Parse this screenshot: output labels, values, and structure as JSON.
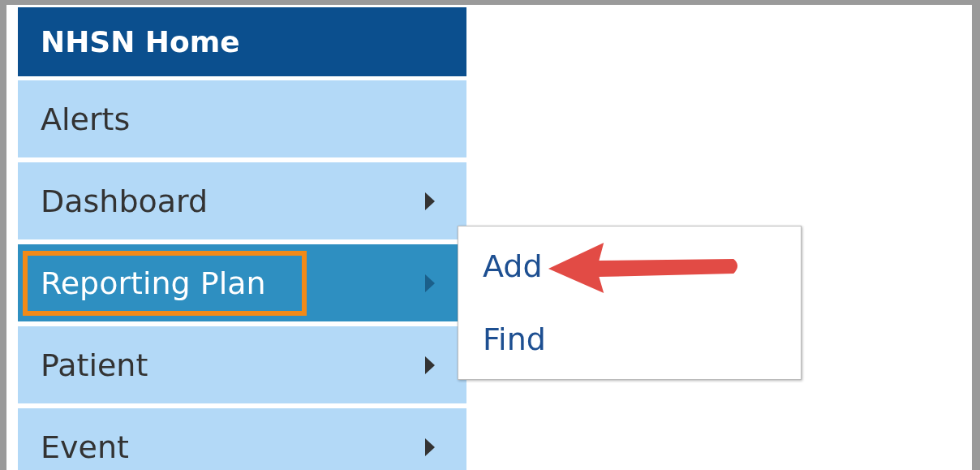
{
  "menu": {
    "header": "NHSN Home",
    "items": [
      {
        "label": "Alerts",
        "has_submenu": false,
        "selected": false,
        "highlighted": false
      },
      {
        "label": "Dashboard",
        "has_submenu": true,
        "selected": false,
        "highlighted": false
      },
      {
        "label": "Reporting Plan",
        "has_submenu": true,
        "selected": true,
        "highlighted": true
      },
      {
        "label": "Patient",
        "has_submenu": true,
        "selected": false,
        "highlighted": false
      },
      {
        "label": "Event",
        "has_submenu": true,
        "selected": false,
        "highlighted": false
      }
    ]
  },
  "submenu": {
    "items": [
      {
        "label": "Add",
        "pointed": true
      },
      {
        "label": "Find",
        "pointed": false
      }
    ]
  }
}
